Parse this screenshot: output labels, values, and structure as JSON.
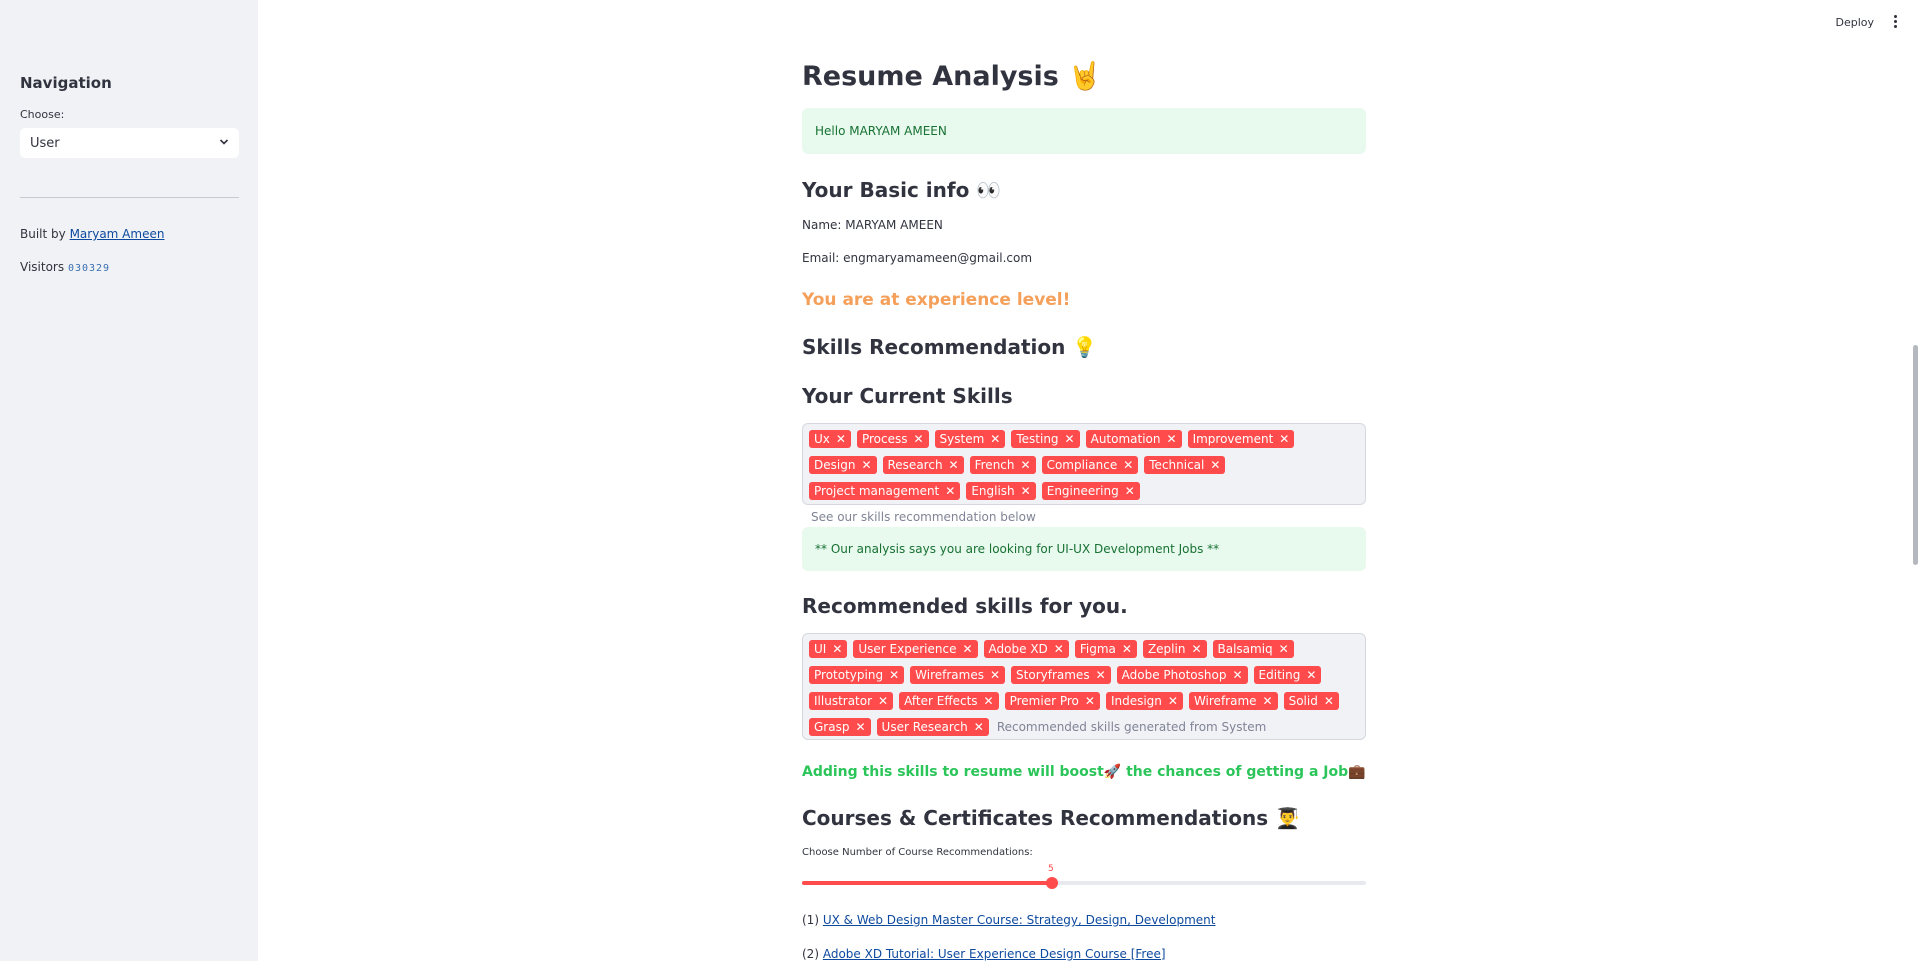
{
  "sidebar": {
    "title": "Navigation",
    "choose_label": "Choose:",
    "select_value": "User",
    "built_prefix": "Built by",
    "author_link": "Maryam Ameen",
    "visitors_label": "Visitors",
    "visitors_count": "030329"
  },
  "header": {
    "deploy_label": "Deploy"
  },
  "main": {
    "title": "Resume Analysis 🤘",
    "hello": "Hello MARYAM AMEEN",
    "basic_info_heading": "Your Basic info 👀",
    "name_line": "Name: MARYAM AMEEN",
    "email_line": "Email: engmaryamameen@gmail.com",
    "experience_line": "You are at experience level!",
    "skills_rec_heading": "Skills Recommendation 💡",
    "current_skills_heading": "Your Current Skills",
    "current_skills": [
      "Ux",
      "Process",
      "System",
      "Testing",
      "Automation",
      "Improvement",
      "Design",
      "Research",
      "French",
      "Compliance",
      "Technical",
      "Project management",
      "English",
      "Engineering"
    ],
    "current_skills_placeholder": "See our skills recommendation below",
    "analysis_alert": "** Our analysis says you are looking for UI-UX Development Jobs **",
    "recommended_heading": "Recommended skills for you.",
    "recommended_skills": [
      "UI",
      "User Experience",
      "Adobe XD",
      "Figma",
      "Zeplin",
      "Balsamiq",
      "Prototyping",
      "Wireframes",
      "Storyframes",
      "Adobe Photoshop",
      "Editing",
      "Illustrator",
      "After Effects",
      "Premier Pro",
      "Indesign",
      "Wireframe",
      "Solid",
      "Grasp",
      "User Research"
    ],
    "recommended_placeholder": "Recommended skills generated from System",
    "boost_line": "Adding this skills to resume will boost🚀 the chances of getting a Job💼",
    "courses_heading": "Courses & Certificates Recommendations 👨‍🎓",
    "slider_label": "Choose Number of Course Recommendations:",
    "slider_value": "5",
    "slider_fraction": 0.4433,
    "courses": [
      {
        "num": "(1)",
        "title": "UX & Web Design Master Course: Strategy, Design, Development"
      },
      {
        "num": "(2)",
        "title": "Adobe XD Tutorial: User Experience Design Course [Free]"
      }
    ]
  },
  "colors": {
    "accent": "#ff4b4b",
    "success_bg": "#e8f9ee",
    "success_text": "#177233",
    "experience": "#f5a05a",
    "boost": "#2bc55a"
  }
}
